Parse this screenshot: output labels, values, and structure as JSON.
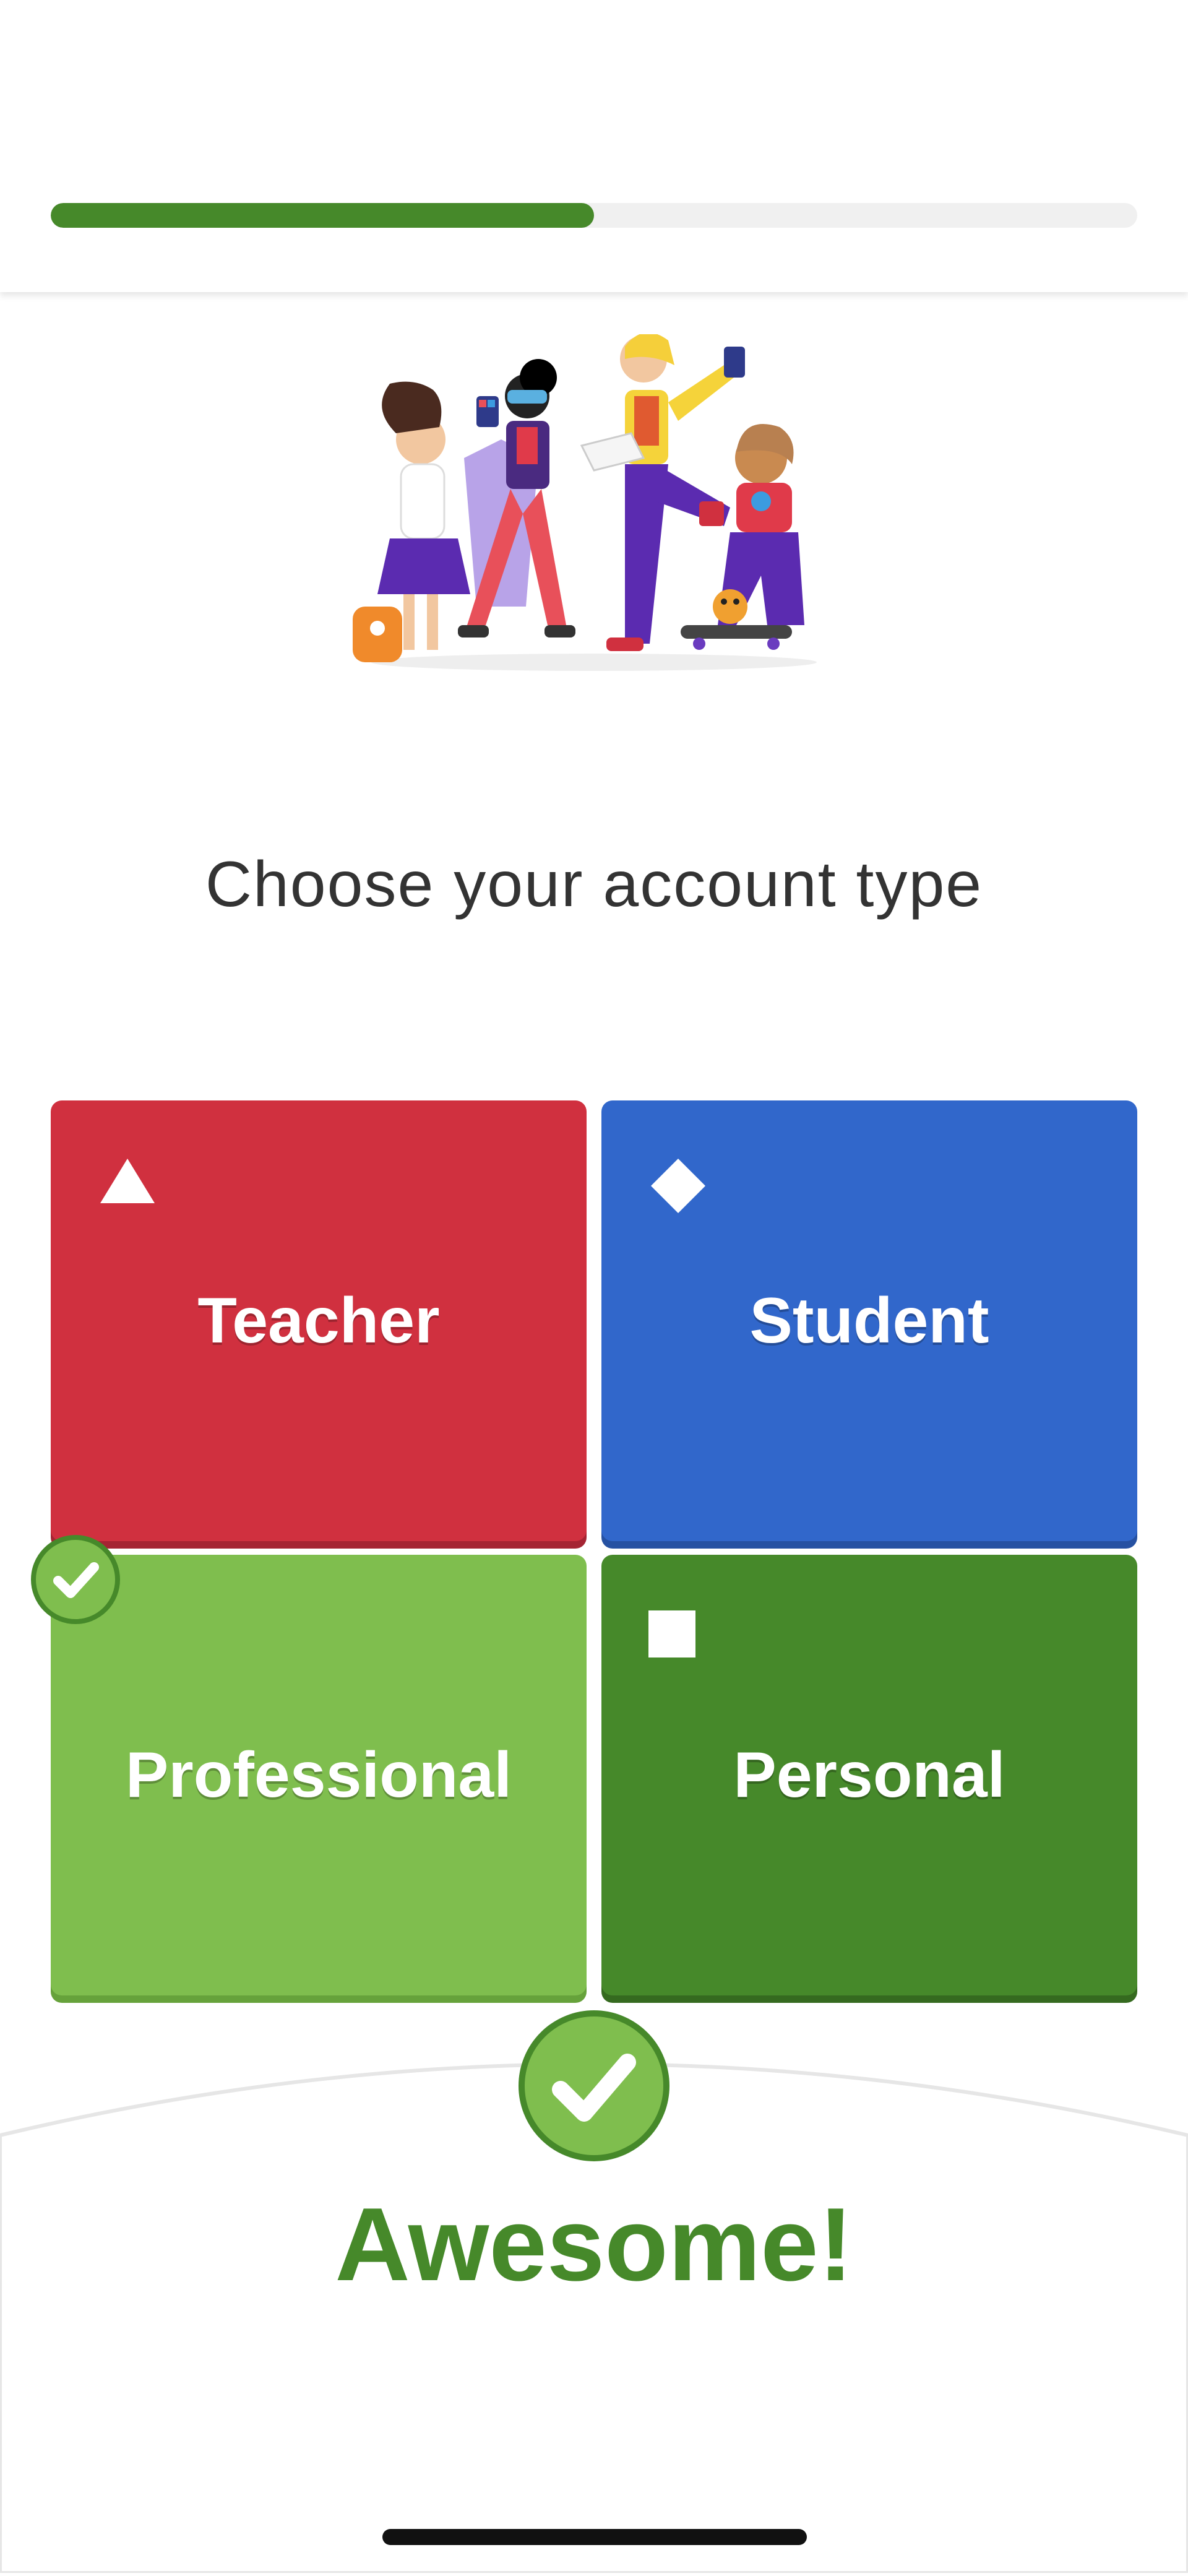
{
  "progress": {
    "value": 0.5
  },
  "page": {
    "title": "Choose your account type"
  },
  "account_types": {
    "teacher": {
      "label": "Teacher",
      "icon": "triangle-icon",
      "color": "#d0303f"
    },
    "student": {
      "label": "Student",
      "icon": "diamond-icon",
      "color": "#3167cb"
    },
    "professional": {
      "label": "Professional",
      "icon": "check-circle-icon",
      "color": "#7fbe4e",
      "selected": true
    },
    "personal": {
      "label": "Personal",
      "icon": "square-icon",
      "color": "#46892a"
    }
  },
  "feedback": {
    "text": "Awesome!",
    "icon": "checkmark-icon"
  },
  "colors": {
    "accent_green": "#46892a",
    "light_green": "#7fbe4e"
  }
}
